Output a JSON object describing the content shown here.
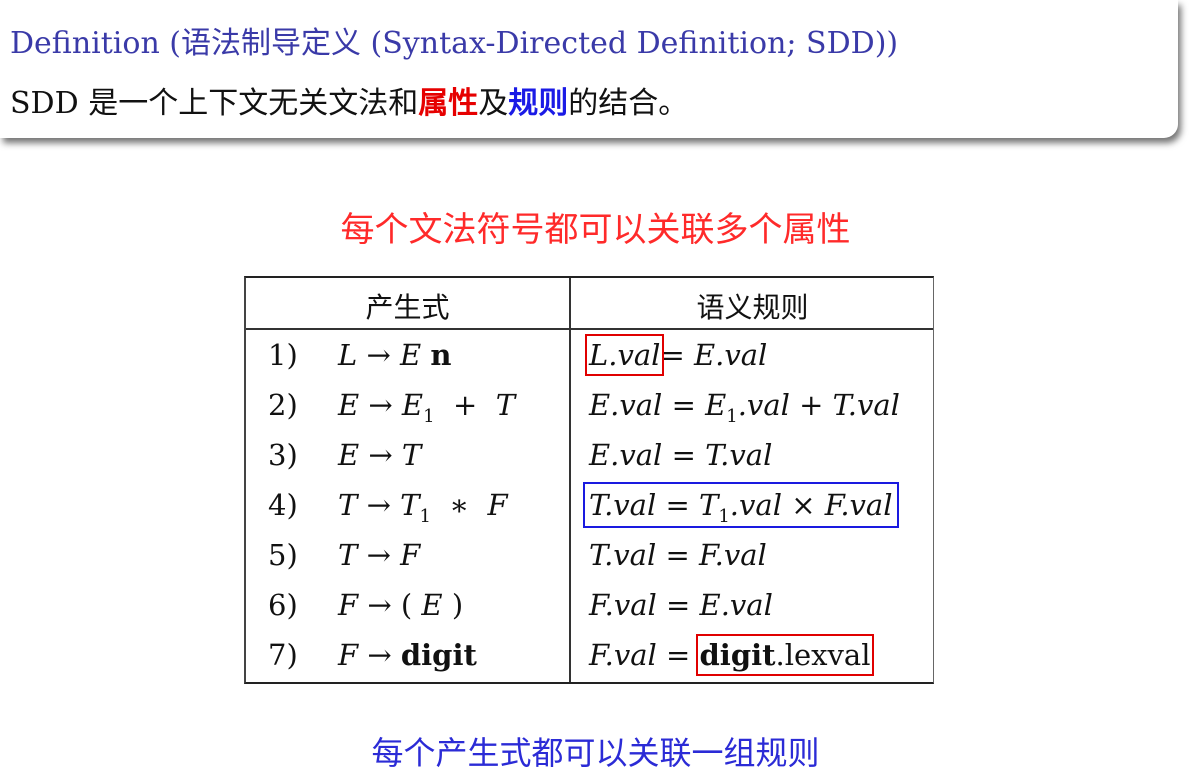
{
  "definition": {
    "title": "Definition (语法制导定义 (Syntax-Directed Definition; SDD))",
    "body_prefix": "SDD 是一个上下文无关文法和",
    "kw_attribute": "属性",
    "body_mid": "及",
    "kw_rule": "规则",
    "body_suffix": "的结合。"
  },
  "note_top": "每个文法符号都可以关联多个属性",
  "note_bottom": "每个产生式都可以关联一组规则",
  "table": {
    "header_production": "产生式",
    "header_rule": "语义规则",
    "rows": [
      {
        "num": "1)",
        "production": "L → E n",
        "rule": "L.val = E.val"
      },
      {
        "num": "2)",
        "production": "E → E1 + T",
        "rule": "E.val = E1.val + T.val"
      },
      {
        "num": "3)",
        "production": "E → T",
        "rule": "E.val = T.val"
      },
      {
        "num": "4)",
        "production": "T → T1 ∗ F",
        "rule": "T.val = T1.val × F.val"
      },
      {
        "num": "5)",
        "production": "T → F",
        "rule": "T.val = F.val"
      },
      {
        "num": "6)",
        "production": "F → ( E )",
        "rule": "F.val = E.val"
      },
      {
        "num": "7)",
        "production": "F → digit",
        "rule": "F.val = digit.lexval"
      }
    ]
  },
  "colors": {
    "title_blue": "#3a3aa8",
    "highlight_red": "#e00000",
    "highlight_blue": "#1a1ae0",
    "note_top": "#ff2a2a",
    "note_bottom": "#2b2bd6"
  }
}
